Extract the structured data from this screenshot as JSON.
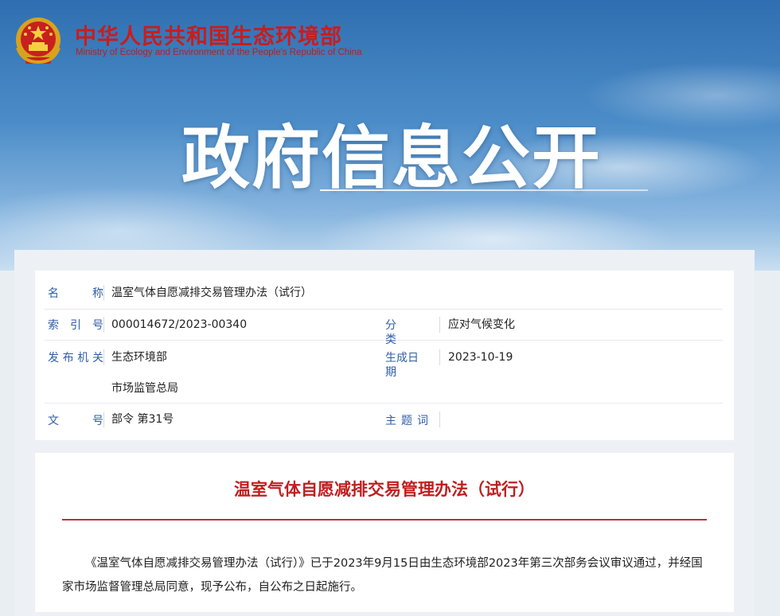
{
  "site": {
    "name_cn": "中华人民共和国生态环境部",
    "name_en": "Ministry of Ecology and Environment of the People's Republic of China"
  },
  "banner": {
    "title": "政府信息公开"
  },
  "meta": {
    "name_label": "名　　称",
    "name_value": "温室气体自愿减排交易管理办法（试行）",
    "index_label": "索 引 号",
    "index_value": "000014672/2023-00340",
    "category_label": "分　　类",
    "category_value": "应对气候变化",
    "issuer_label": "发布机关",
    "issuer_values": [
      "生态环境部",
      "市场监管总局"
    ],
    "date_label": "生成日期",
    "date_value": "2023-10-19",
    "doc_no_label": "文　　号",
    "doc_no_value": "部令 第31号",
    "keywords_label": "主 题 词",
    "keywords_value": ""
  },
  "article": {
    "title": "温室气体自愿减排交易管理办法（试行）",
    "paragraph": "《温室气体自愿减排交易管理办法（试行）》已于2023年9月15日由生态环境部2023年第三次部务会议审议通过，并经国家市场监督管理总局同意，现予公布，自公布之日起施行。"
  },
  "colors": {
    "brand_red": "#c81d1d",
    "label_blue": "#2f5ea8",
    "rule_red": "#b73434"
  }
}
